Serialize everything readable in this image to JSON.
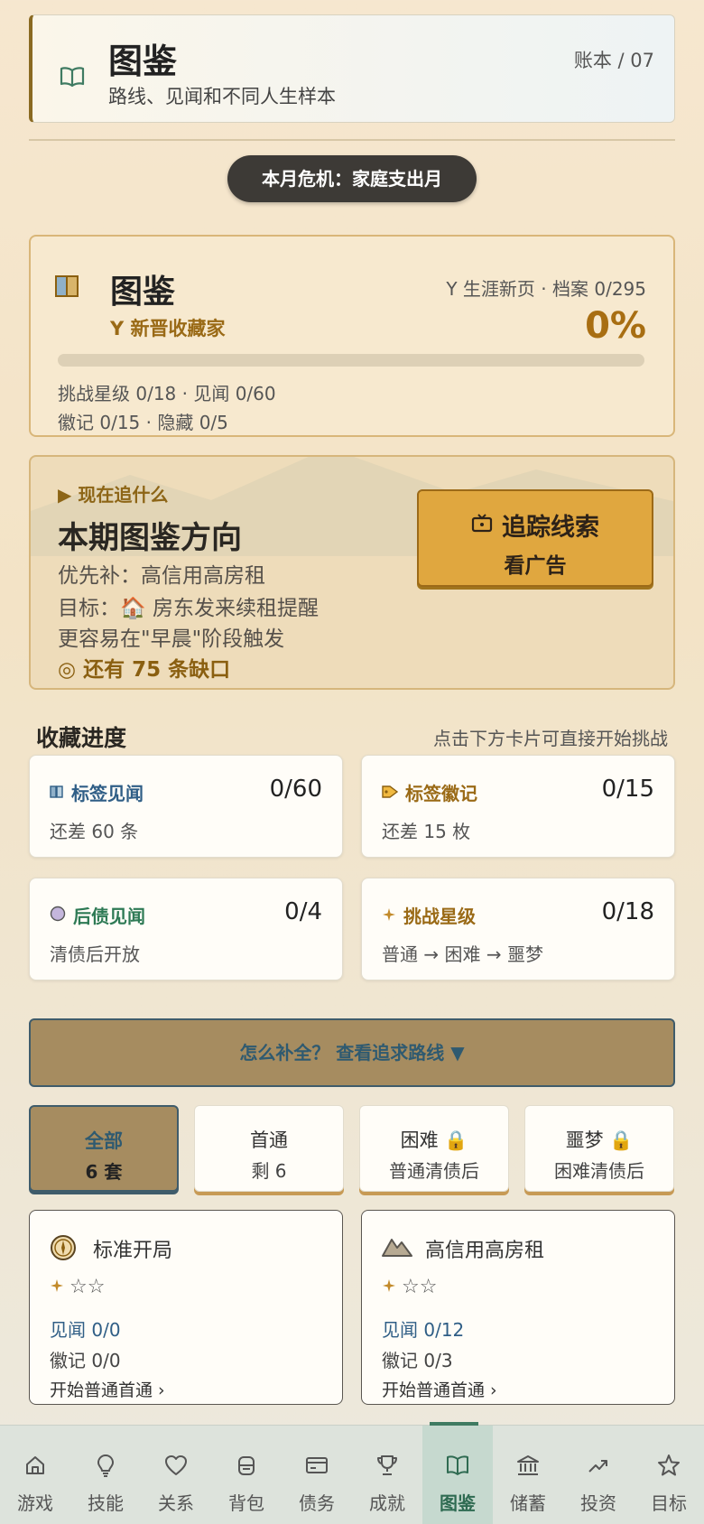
{
  "header": {
    "title": "图鉴",
    "subtitle": "路线、见闻和不同人生样本",
    "ledger": "账本 / 07",
    "icon": "open-book-icon"
  },
  "crisis": {
    "label": "本月危机：家庭支出月"
  },
  "collection": {
    "title": "图鉴",
    "rank": "新晋收藏家",
    "new_page": "生涯新页 · 档案 0/295",
    "percent_text": "0%",
    "progress": 0,
    "stats_line1": "挑战星级 0/18 · 见闻 0/60",
    "stats_line2": "徽记 0/15 · 隐藏 0/5"
  },
  "direction": {
    "eyebrow": "现在追什么",
    "title": "本期图鉴方向",
    "priority": "优先补：高信用高房租",
    "goal": "目标：🏠 房东发来续租提醒",
    "trigger": "更容易在\"早晨\"阶段触发",
    "gap": "还有 75 条缺口",
    "track_button": "追踪线索",
    "track_sub": "看广告"
  },
  "progress_section": {
    "title": "收藏进度",
    "hint": "点击下方卡片可直接开始挑战",
    "cards": [
      {
        "label": "标签见闻",
        "value": "0/60",
        "sub": "还差 60 条",
        "color": "#2f5e86",
        "icon": "book-icon"
      },
      {
        "label": "标签徽记",
        "value": "0/15",
        "sub": "还差 15 枚",
        "color": "#9a6a16",
        "icon": "tag-icon"
      },
      {
        "label": "后债见闻",
        "value": "0/4",
        "sub": "清债后开放",
        "color": "#2e7a55",
        "icon": "circle-icon"
      },
      {
        "label": "挑战星级",
        "value": "0/18",
        "sub": "普通 → 困难 → 噩梦",
        "color": "#9a6a16",
        "icon": "sparkle-icon"
      }
    ]
  },
  "route_button": {
    "label": "怎么补全？  查看追求路线 ▼"
  },
  "filters": [
    {
      "name": "全部",
      "sub": "6 套"
    },
    {
      "name": "首通",
      "sub": "剩 6"
    },
    {
      "name": "困难 🔒",
      "sub": "普通清债后"
    },
    {
      "name": "噩梦 🔒",
      "sub": "困难清债后"
    }
  ],
  "routes": [
    {
      "title": "标准开局",
      "stars": "☆☆",
      "seen": "见闻 0/0",
      "badge": "徽记 0/0",
      "start": "开始普通首通 ›",
      "icon": "compass-icon"
    },
    {
      "title": "高信用高房租",
      "stars": "☆☆",
      "seen": "见闻 0/12",
      "badge": "徽记 0/3",
      "start": "开始普通首通 ›",
      "icon": "mountain-icon"
    }
  ],
  "nav": [
    {
      "label": "游戏",
      "icon": "home-icon"
    },
    {
      "label": "技能",
      "icon": "lightbulb-icon"
    },
    {
      "label": "关系",
      "icon": "heart-icon"
    },
    {
      "label": "背包",
      "icon": "backpack-icon"
    },
    {
      "label": "债务",
      "icon": "card-icon"
    },
    {
      "label": "成就",
      "icon": "trophy-icon"
    },
    {
      "label": "图鉴",
      "icon": "book-icon"
    },
    {
      "label": "储蓄",
      "icon": "bank-icon"
    },
    {
      "label": "投资",
      "icon": "trend-icon"
    },
    {
      "label": "目标",
      "icon": "star-icon"
    }
  ]
}
